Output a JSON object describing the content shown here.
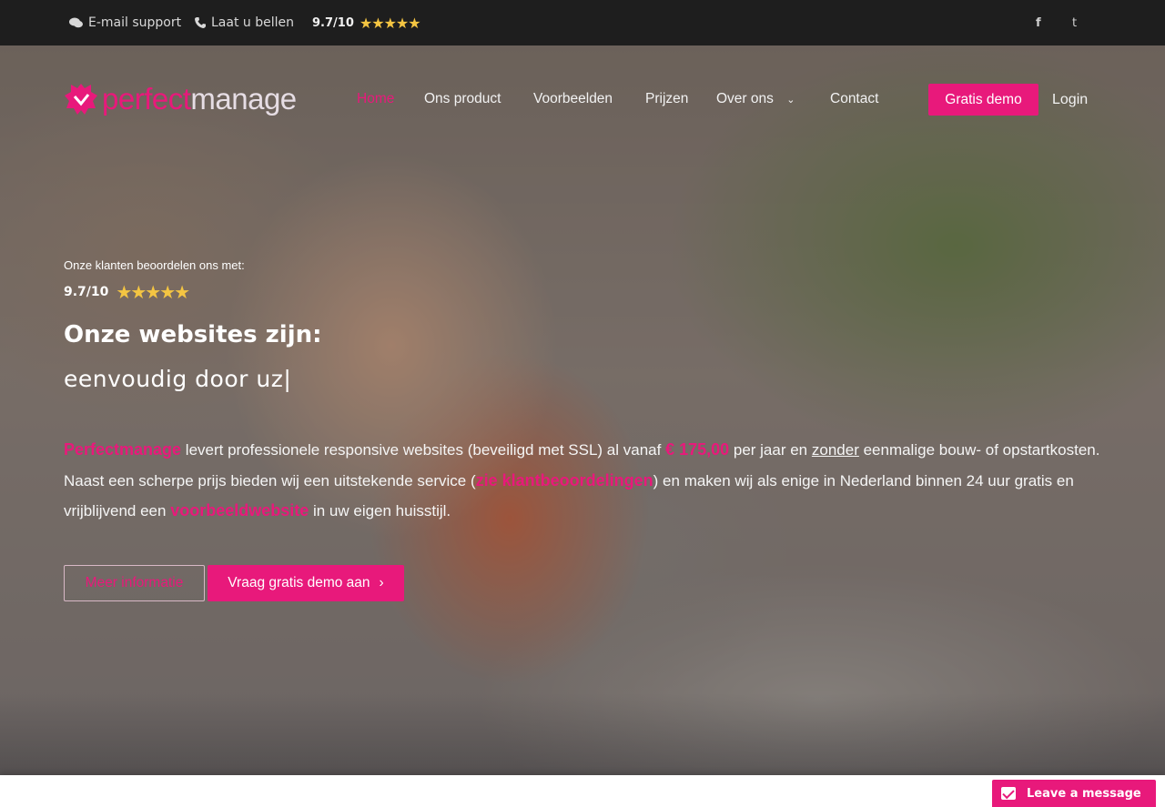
{
  "topbar": {
    "email_label": "E-mail support",
    "email_icon": "chat-bubbles-icon",
    "phone_label": "Laat u bellen",
    "phone_icon": "phone-icon",
    "rating": "9.7/10",
    "stars": "★★★★★",
    "social_facebook": "f",
    "social_twitter": "t"
  },
  "brand": {
    "logo_part1": "perfect",
    "logo_part2": "manage",
    "accent_color": "#e8197b"
  },
  "nav": {
    "home": "Home",
    "product": "Ons product",
    "examples": "Voorbeelden",
    "prices": "Prijzen",
    "about": "Over ons",
    "contact": "Contact",
    "demo_button": "Gratis demo",
    "login": "Login"
  },
  "hero": {
    "rating_intro": "Onze klanten beoordelen ons met:",
    "rating": "9.7/10",
    "stars": "★★★★★",
    "title": "Onze websites zijn:",
    "subtitle": "eenvoudig door uz|",
    "desc": {
      "brand": "Perfectmanage",
      "t1": " levert professionele responsive websites (beveiligd met SSL) al vanaf ",
      "price": "€ 175,00",
      "t2": " per jaar en ",
      "zonder": "zonder",
      "t3": " eenmalige bouw- of opstartkosten. Naast een scherpe prijs bieden wij een uitstekende service (",
      "reviews_link": "zie klantbeoordelingen",
      "t4": ") en maken wij als enige in Nederland binnen 24 uur gratis en vrijblijvend een ",
      "example_link": "voorbeeldwebsite",
      "t5": " in uw eigen huisstijl."
    },
    "btn_more": "Meer informatie",
    "btn_demo": "Vraag gratis demo aan",
    "btn_demo_icon": "chevron-right-icon"
  },
  "chat": {
    "label": "Leave a message",
    "icon": "envelope-icon"
  }
}
